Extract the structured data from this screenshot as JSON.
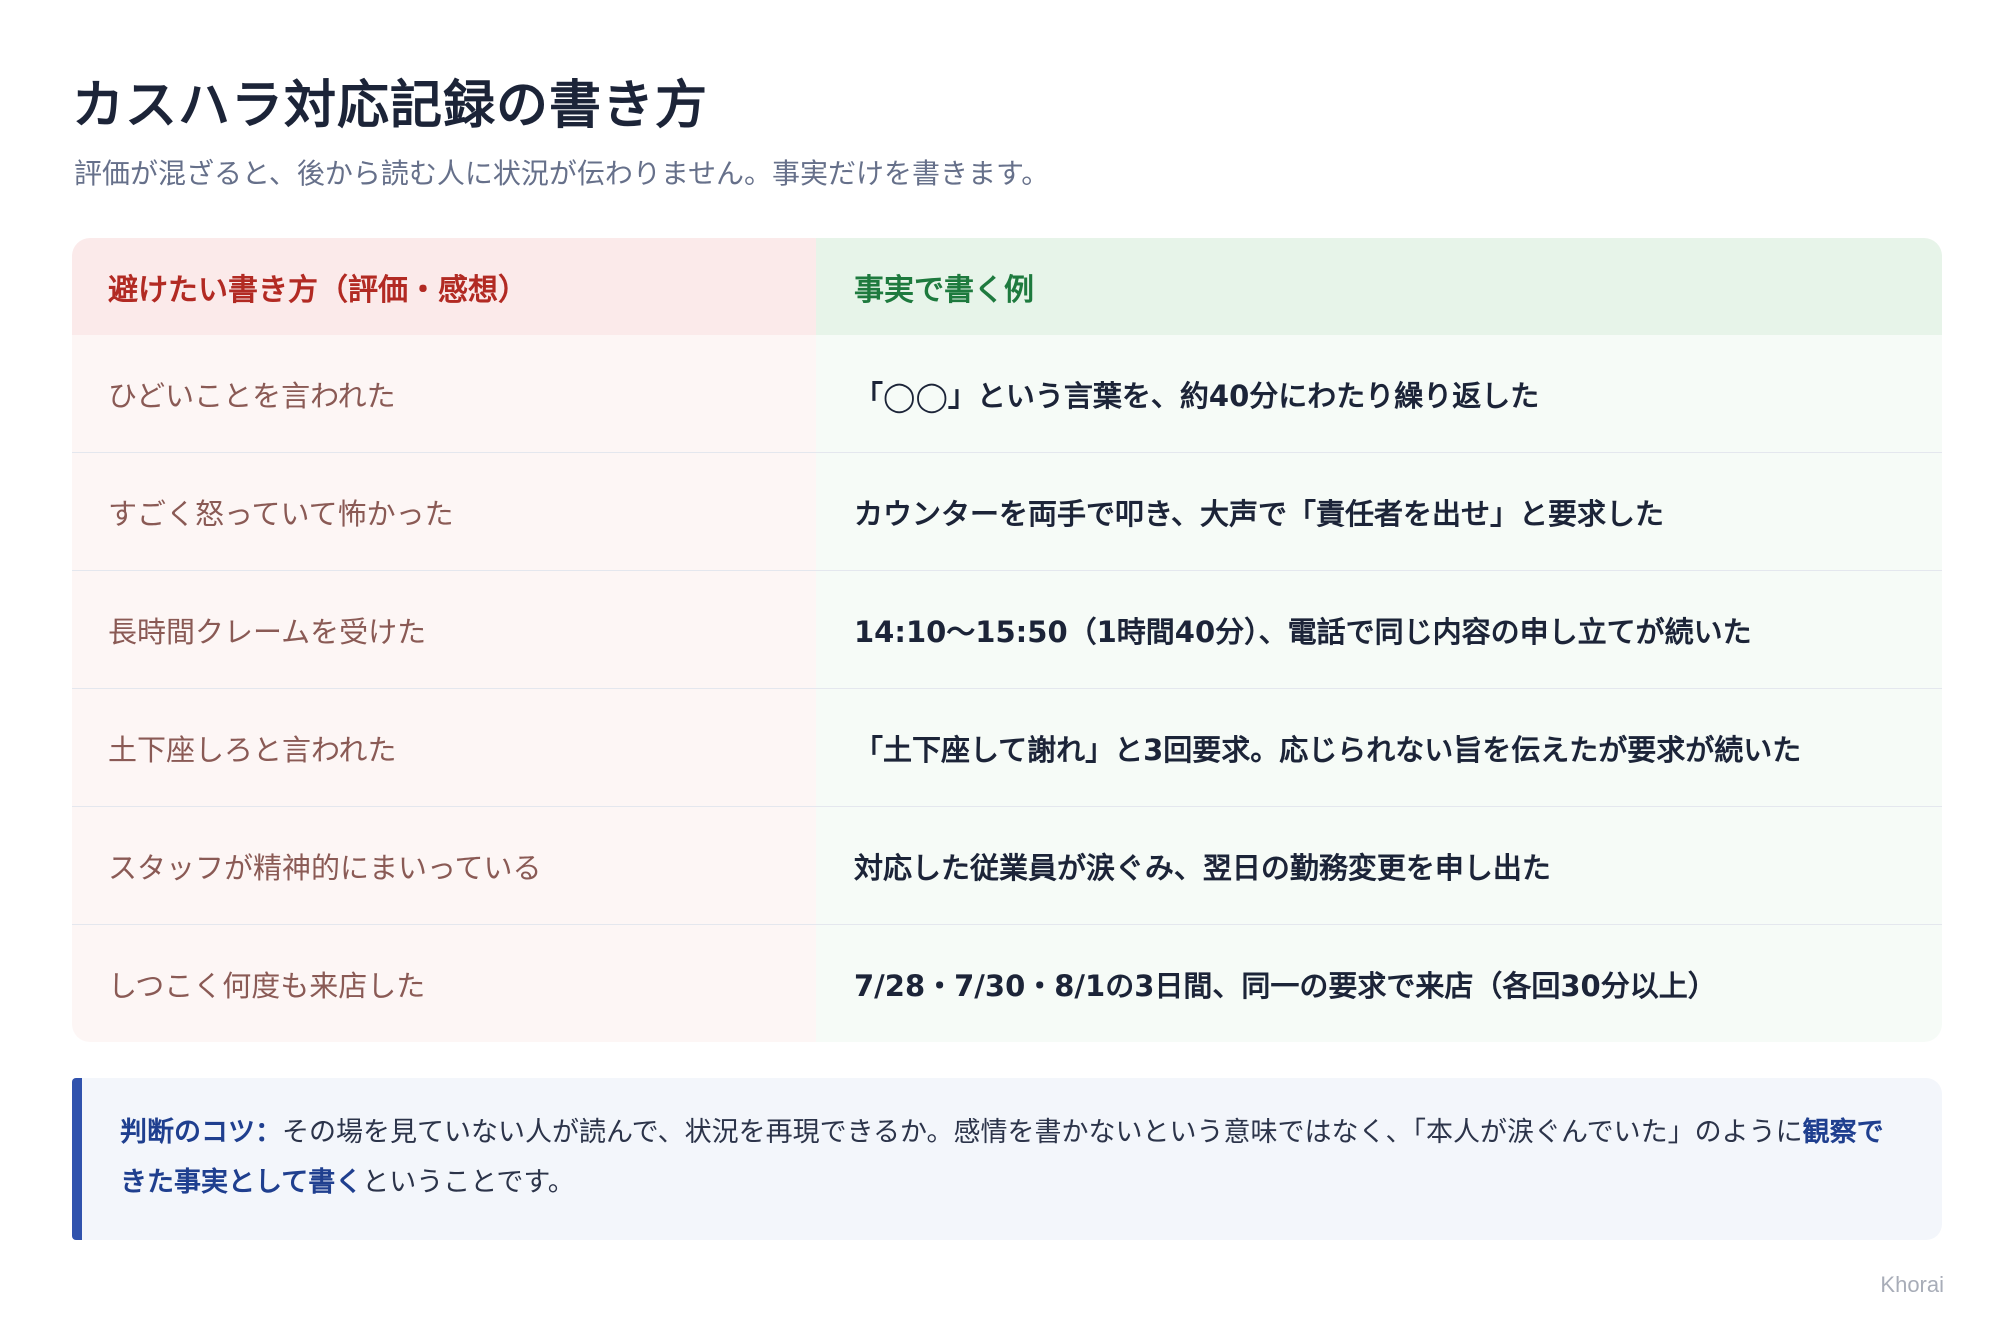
{
  "header": {
    "title": "カスハラ対応記録の書き方",
    "subtitle": "評価が混ざると、後から読む人に状況が伝わりません。事実だけを書きます。"
  },
  "table": {
    "columns": {
      "bad": "避けたい書き方（評価・感想）",
      "good": "事実で書く例"
    },
    "rows": [
      {
        "bad": "ひどいことを言われた",
        "good": "「◯◯」という言葉を、約40分にわたり繰り返した"
      },
      {
        "bad": "すごく怒っていて怖かった",
        "good": "カウンターを両手で叩き、大声で「責任者を出せ」と要求した"
      },
      {
        "bad": "長時間クレームを受けた",
        "good": "14:10〜15:50（1時間40分）、電話で同じ内容の申し立てが続いた"
      },
      {
        "bad": "土下座しろと言われた",
        "good": "「土下座して謝れ」と3回要求。応じられない旨を伝えたが要求が続いた"
      },
      {
        "bad": "スタッフが精神的にまいっている",
        "good": "対応した従業員が涙ぐみ、翌日の勤務変更を申し出た"
      },
      {
        "bad": "しつこく何度も来店した",
        "good": "7/28・7/30・8/1の3日間、同一の要求で来店（各回30分以上）"
      }
    ]
  },
  "tip": {
    "label": "判断のコツ：",
    "text_before": "その場を見ていない人が読んで、状況を再現できるか。感情を書かないという意味ではなく、「本人が涙ぐんでいた」のように",
    "emphasis": "観察できた事実として書く",
    "text_after": "ということです。"
  },
  "footer": {
    "credit": "Khorai"
  },
  "colors": {
    "bad_header_bg": "#fbeaea",
    "bad_header_text": "#b22a23",
    "good_header_bg": "#e7f4e9",
    "good_header_text": "#1e7a3e",
    "tip_accent": "#3052ad"
  }
}
